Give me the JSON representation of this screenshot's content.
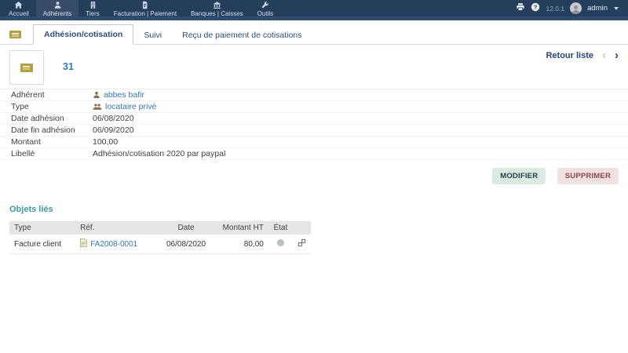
{
  "topbar": {
    "nav": [
      {
        "label": "Accueil",
        "icon": "home-icon",
        "active": false
      },
      {
        "label": "Adhérents",
        "icon": "members-icon",
        "active": true
      },
      {
        "label": "Tiers",
        "icon": "thirdparties-icon",
        "active": false
      },
      {
        "label": "Facturation | Paiement",
        "icon": "billing-icon",
        "active": false
      },
      {
        "label": "Banques | Caisses",
        "icon": "bank-icon",
        "active": false
      },
      {
        "label": "Outils",
        "icon": "tools-icon",
        "active": false
      }
    ],
    "right": {
      "print_icon": "printer-icon",
      "help_icon": "help-icon",
      "version": "12.0.1",
      "user": "admin",
      "user_icon": "avatar",
      "dropdown_icon": "chevron-down-icon"
    }
  },
  "tabs": {
    "picto": "member-card-icon",
    "items": [
      {
        "label": "Adhésion/cotisation",
        "active": true
      },
      {
        "label": "Suivi",
        "active": false
      },
      {
        "label": "Reçu de paiement de cotisations",
        "active": false
      }
    ]
  },
  "header": {
    "ref": "31",
    "photo_icon": "member-card-icon",
    "back_to_list": "Retour liste",
    "prev": "‹",
    "next": "›"
  },
  "fields": [
    {
      "label": "Adhérent",
      "value": "abbes bafir",
      "icon": "user-icon",
      "link": true
    },
    {
      "label": "Type",
      "value": "locataire privé",
      "icon": "group-icon",
      "link": true
    },
    {
      "label": "Date adhésion",
      "value": "06/08/2020"
    },
    {
      "label": "Date fin adhésion",
      "value": "06/09/2020"
    },
    {
      "label": "Montant",
      "value": "100,00"
    },
    {
      "label": "Libellé",
      "value": "Adhésion/cotisation 2020 par paypal"
    }
  ],
  "actions": {
    "modify": "MODIFIER",
    "delete": "SUPPRIMER"
  },
  "linked_objects": {
    "title": "Objets liés",
    "columns": [
      "Type",
      "Réf.",
      "Date",
      "Montant HT",
      "État",
      ""
    ],
    "rows": [
      {
        "type": "Facture client",
        "ref": "FA2008-0001",
        "ref_icon": "invoice-icon",
        "date": "06/08/2020",
        "amount_ht": "80,00",
        "status": "draft",
        "status_icon": "status-draft-icon",
        "action_icon": "unlink-icon"
      }
    ]
  },
  "colors": {
    "topbar_bg": "#243e5c",
    "topbar_strip": "#2d4d70",
    "link_blue": "#2c7ab8",
    "tab_text": "#2b4d7e",
    "back_list": "#26427c",
    "section_title_teal": "#3c9aa2",
    "btn_modify_bg": "#d8ecdf",
    "btn_delete_bg": "#f1e2e2",
    "btn_delete_text": "#8d4444",
    "status_draft": "#b5c0c2",
    "member_card_gold": "#b3a13d",
    "table_header_bg": "#e5e5e5"
  }
}
